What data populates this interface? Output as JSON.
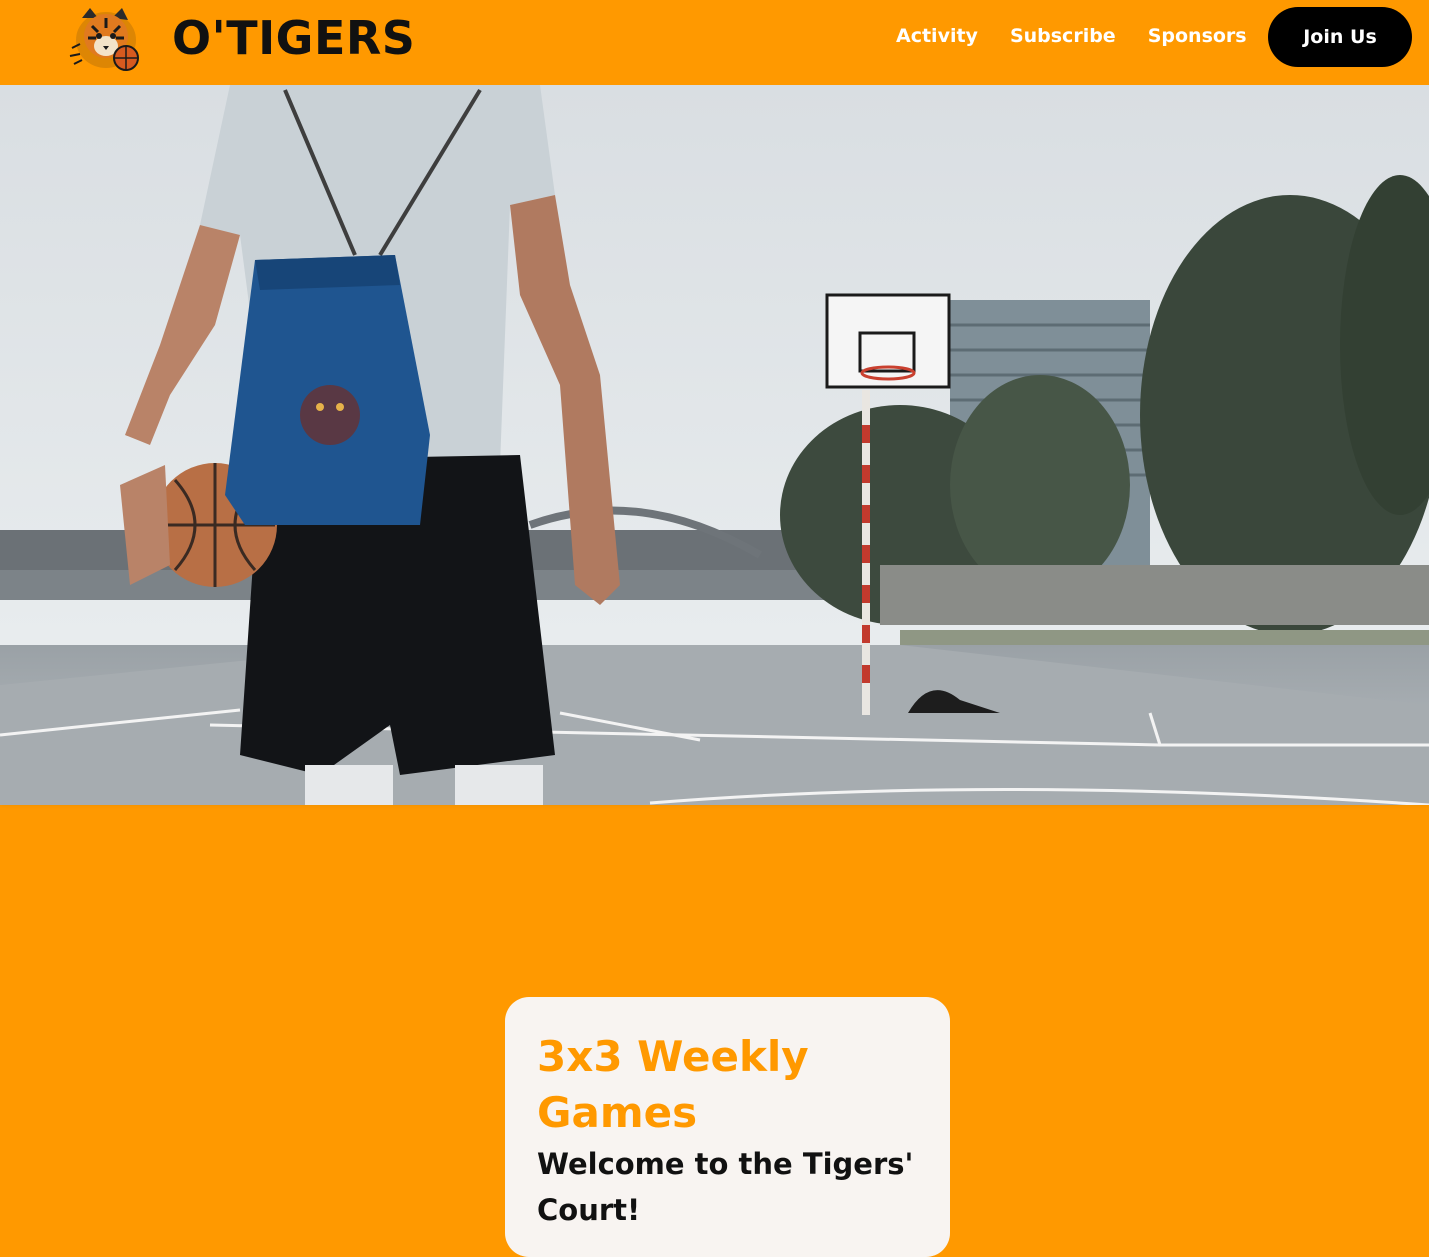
{
  "header": {
    "brand": "O'TIGERS",
    "logo_icon": "tiger-basketball-logo-icon",
    "nav": [
      {
        "label": "Activity"
      },
      {
        "label": "Subscribe"
      },
      {
        "label": "Sponsors"
      }
    ],
    "cta_label": "Join Us"
  },
  "hero": {
    "image": "basketball-player-outdoor-court-photo",
    "alt": "Player with a tiger-logo drawstring bag holding a basketball on an outdoor court"
  },
  "card": {
    "title": "3x3 Weekly Games",
    "subtitle": "Welcome to the Tigers' Court!"
  },
  "colors": {
    "brand_orange": "#FF9900",
    "text_dark": "#111111",
    "card_bg": "#F8F4F1",
    "button_bg": "#000000"
  }
}
